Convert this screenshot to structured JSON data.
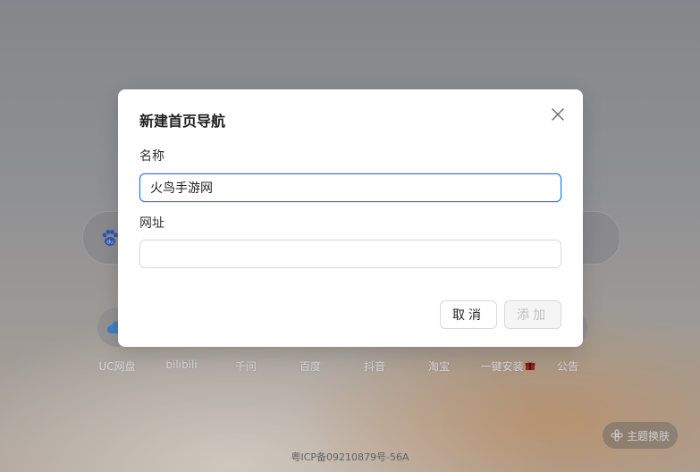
{
  "background": {
    "shortcuts": [
      {
        "label": "UC网盘",
        "icon": "cloud-icon"
      },
      {
        "label": "bilibili",
        "icon": "bilibili-icon"
      },
      {
        "label": "千问",
        "icon": "qianwen-icon"
      },
      {
        "label": "百度",
        "icon": "baidu-icon"
      },
      {
        "label": "抖音",
        "icon": "douyin-icon"
      },
      {
        "label": "淘宝",
        "icon": "taobao-icon"
      },
      {
        "label": "一键安装",
        "icon": "gift-icon"
      },
      {
        "label": "公告",
        "icon": "announcement-icon"
      }
    ],
    "search_engine_icon": "baidu-paw-icon",
    "icp": "粤ICP备09210879号-56A",
    "theme_button": "主题换肤"
  },
  "dialog": {
    "title": "新建首页导航",
    "name_label": "名称",
    "name_value": "火鸟手游网",
    "url_label": "网址",
    "url_value": "",
    "cancel_label": "取消",
    "add_label": "添加",
    "close_icon": "close-icon"
  },
  "colors": {
    "focus_border": "#1677ff",
    "disabled_bg": "#f5f5f5",
    "disabled_text": "#bfbfbf"
  }
}
